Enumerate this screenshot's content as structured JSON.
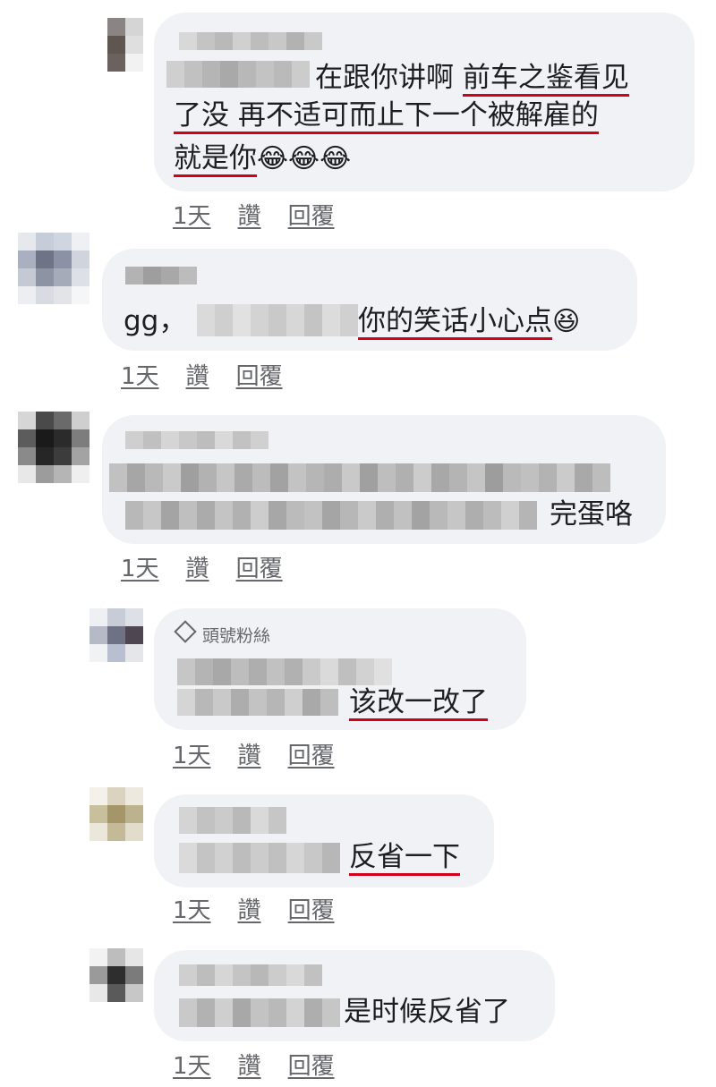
{
  "comments": [
    {
      "text_parts": [
        "在跟你讲啊 ",
        "前车之鉴看见",
        "了没 再不适可而止下一个被解雇的",
        "就是你"
      ],
      "emoji": "😂😂😂",
      "actions": {
        "time": "1天",
        "like": "讚",
        "reply": "回覆"
      }
    },
    {
      "prefix": "gg，",
      "text": "你的笑话小心点",
      "emoji": "😆",
      "actions": {
        "time": "1天",
        "like": "讚",
        "reply": "回覆"
      }
    },
    {
      "text": "完蛋咯",
      "actions": {
        "time": "1天",
        "like": "讚",
        "reply": "回覆"
      }
    },
    {
      "badge": "頭號粉絲",
      "text": "该改一改了",
      "actions": {
        "time": "1天",
        "like": "讚",
        "reply": "回覆"
      }
    },
    {
      "text": "反省一下",
      "actions": {
        "time": "1天",
        "like": "讚",
        "reply": "回覆"
      }
    },
    {
      "text": "是时候反省了",
      "actions": {
        "time": "1天",
        "like": "讚",
        "reply": "回覆"
      }
    }
  ],
  "colors": {
    "underline": "#d0021b",
    "bubble": "#f0f2f5",
    "meta": "#65676b"
  },
  "icons": [
    "diamond-icon"
  ]
}
